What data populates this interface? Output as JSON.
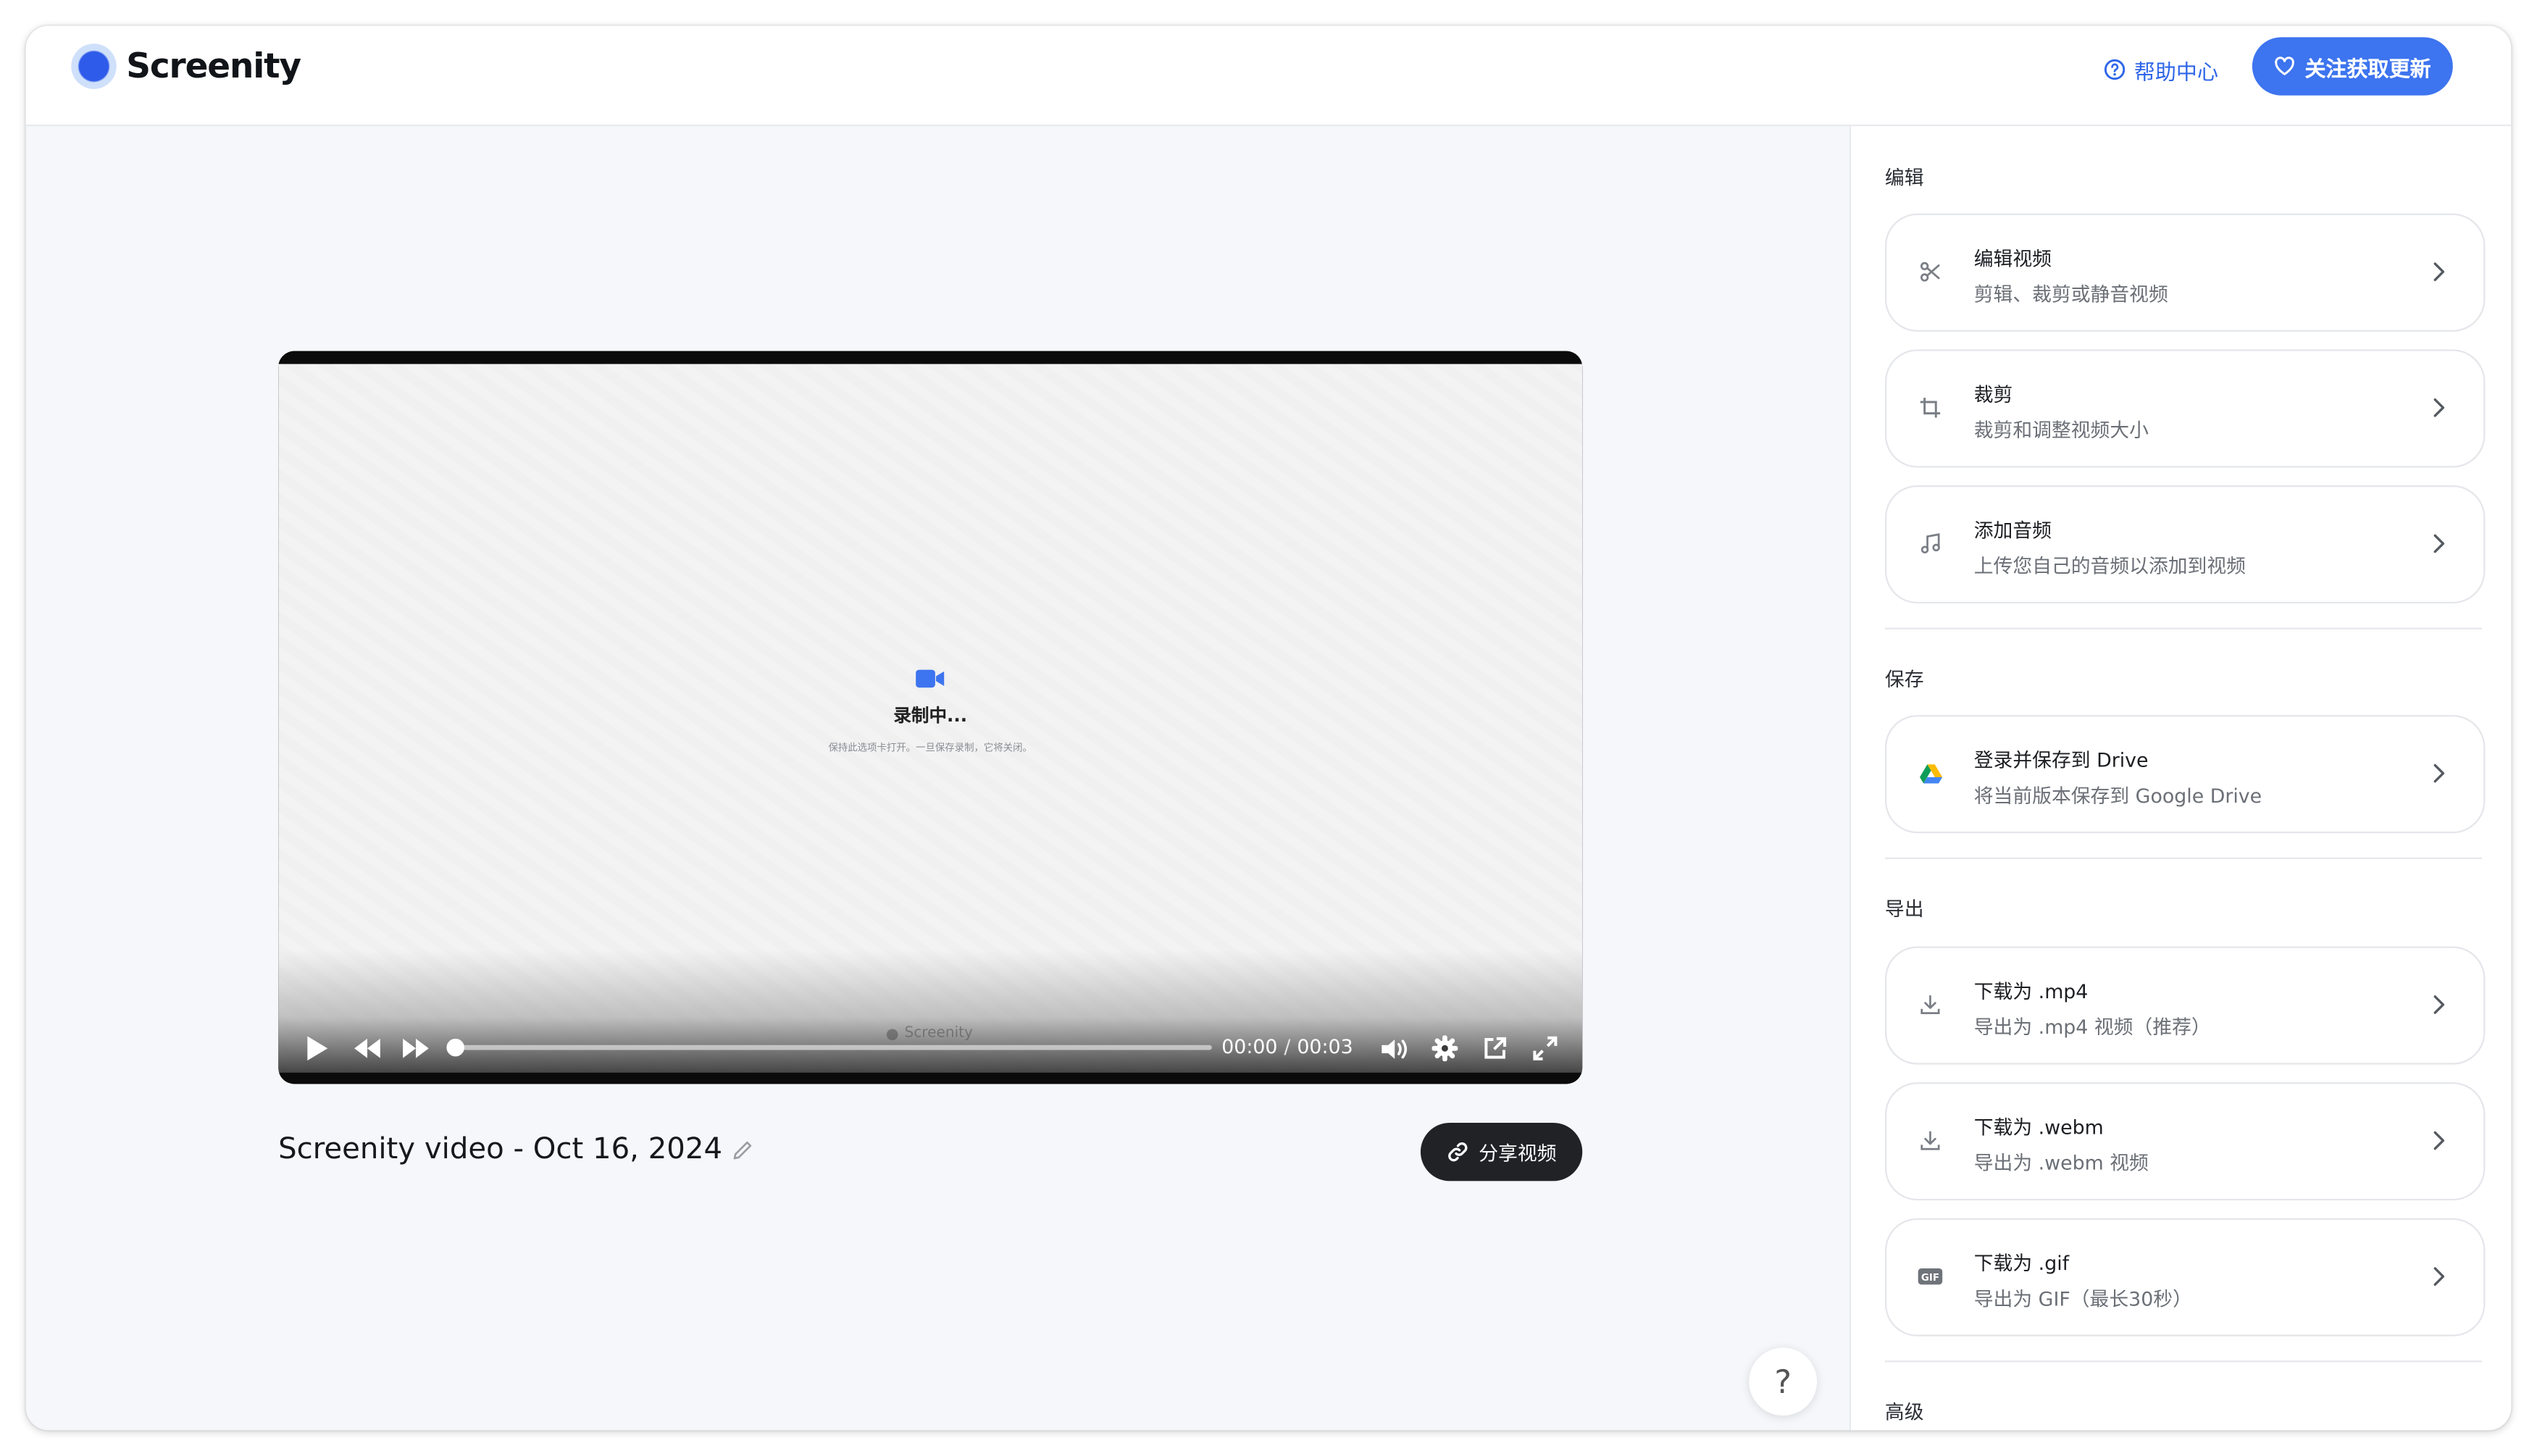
{
  "header": {
    "brand": "Screenity",
    "help_label": "帮助中心",
    "follow_label": "关注获取更新"
  },
  "player": {
    "recording_title": "录制中...",
    "recording_subtitle": "保持此选项卡打开。一旦保存录制，它将关闭。",
    "watermark": "Screenity",
    "time_current": "00:00",
    "time_total": "00:03",
    "progress": 0.0
  },
  "video_title": "Screenity video - Oct 16, 2024",
  "share_label": "分享视频",
  "help_fab": "?",
  "sidebar": {
    "edit_section": "编辑",
    "edit_items": [
      {
        "title": "编辑视频",
        "subtitle": "剪辑、裁剪或静音视频"
      },
      {
        "title": "裁剪",
        "subtitle": "裁剪和调整视频大小"
      },
      {
        "title": "添加音频",
        "subtitle": "上传您自己的音频以添加到视频"
      }
    ],
    "save_section": "保存",
    "save_items": [
      {
        "title": "登录并保存到 Drive",
        "subtitle": "将当前版本保存到 Google Drive"
      }
    ],
    "export_section": "导出",
    "export_items": [
      {
        "title": "下载为 .mp4",
        "subtitle": "导出为 .mp4 视频（推荐）"
      },
      {
        "title": "下载为 .webm",
        "subtitle": "导出为 .webm 视频"
      },
      {
        "title": "下载为 .gif",
        "subtitle": "导出为 GIF（最长30秒）"
      }
    ],
    "advanced_section": "高级"
  },
  "colors": {
    "accent": "#3d74ef",
    "dark_button": "#212226",
    "background": "#f6f7fa"
  },
  "icons": {
    "help": "question-circle-icon",
    "follow": "heart-icon",
    "share": "link-icon",
    "edit": "scissors-icon",
    "crop": "crop-icon",
    "audio": "music-note-icon",
    "drive": "google-drive-icon",
    "download": "download-icon",
    "gif": "gif-icon"
  }
}
